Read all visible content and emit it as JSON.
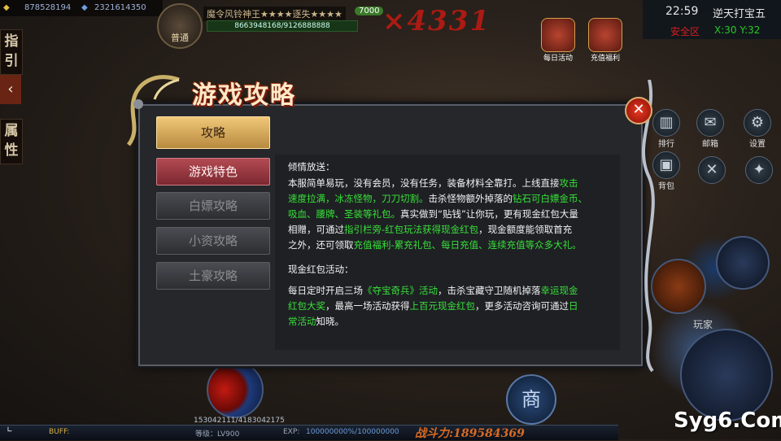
{
  "hud": {
    "gold": "878528194",
    "ingot": "2321614350",
    "player_title_left": "魔令",
    "player_name": "风铃神王★★★★逐失★★★★",
    "player_level": "7000",
    "hp_text": "8663948168/9126888888",
    "avatar_label": "普通",
    "damage_text": "×4331",
    "side_tab_guide": "指引",
    "side_tab_attr": "属性",
    "daily_activity": "每日活动",
    "recharge_benefit": "充值福利",
    "time": "22:59",
    "map_name": "逆天打宝五",
    "safe_zone": "安全区",
    "coords": "X:30 Y:32",
    "rank_label": "排行",
    "mail_label": "邮箱",
    "settings_label": "设置",
    "bag_label": "背包",
    "player_label": "玩家",
    "shop_label": "商",
    "buff_label": "BUFF:",
    "level_label": "等级：LV900",
    "exp_label": "EXP:",
    "exp_value": "100000000%/100000000",
    "hp_mini": "153042111/4183042175",
    "combat_power": "战斗力:189584369",
    "logo_text": "Syg6.Com"
  },
  "dialog": {
    "title": "游戏攻略",
    "active_tab": "攻略",
    "menu": [
      "游戏特色",
      "白嫖攻略",
      "小资攻略",
      "土豪攻略"
    ],
    "section1_heading": "倾情放送：",
    "section1_lines": [
      [
        {
          "t": "本服简单易玩，没有会员，没有任务，装备材料全靠打。上线直接"
        },
        {
          "t": "攻击",
          "c": "g"
        }
      ],
      [
        {
          "t": "速度拉满，冰冻怪物，刀刀切割。",
          "c": "g"
        },
        {
          "t": "击杀怪物额外掉落的"
        },
        {
          "t": "钻石可白嫖金币、",
          "c": "g"
        }
      ],
      [
        {
          "t": "吸血、腰牌、圣装等礼包。",
          "c": "g"
        },
        {
          "t": "真实做到“贴钱”让你玩，更有现金红包大量"
        }
      ],
      [
        {
          "t": "相赠，可通过"
        },
        {
          "t": "指引栏旁-红包玩法获得现金红包",
          "c": "g"
        },
        {
          "t": "，现金额度能领取首充"
        }
      ],
      [
        {
          "t": "之外，还可领取"
        },
        {
          "t": "充值福利-累充礼包、每日充值、连续充值等众多大礼。",
          "c": "g"
        }
      ]
    ],
    "section2_heading": "现金红包活动：",
    "section2_lines": [
      [
        {
          "t": "每日定时开启三场"
        },
        {
          "t": "《夺宝奇兵》活动",
          "c": "g"
        },
        {
          "t": "，击杀宝藏守卫随机掉落"
        },
        {
          "t": "幸运现金",
          "c": "g"
        }
      ],
      [
        {
          "t": "红包大奖",
          "c": "g"
        },
        {
          "t": "，最高一场活动获得"
        },
        {
          "t": "上百元现金红包",
          "c": "g"
        },
        {
          "t": "，更多活动咨询可通过"
        },
        {
          "t": "日",
          "c": "g"
        }
      ],
      [
        {
          "t": "常活动",
          "c": "g"
        },
        {
          "t": "知晓。"
        }
      ]
    ]
  },
  "colors": {
    "accent_green": "#38e038",
    "dialog_bg": "#25272b",
    "active_tab": "#f0c878",
    "special_tab": "#b34a52"
  }
}
